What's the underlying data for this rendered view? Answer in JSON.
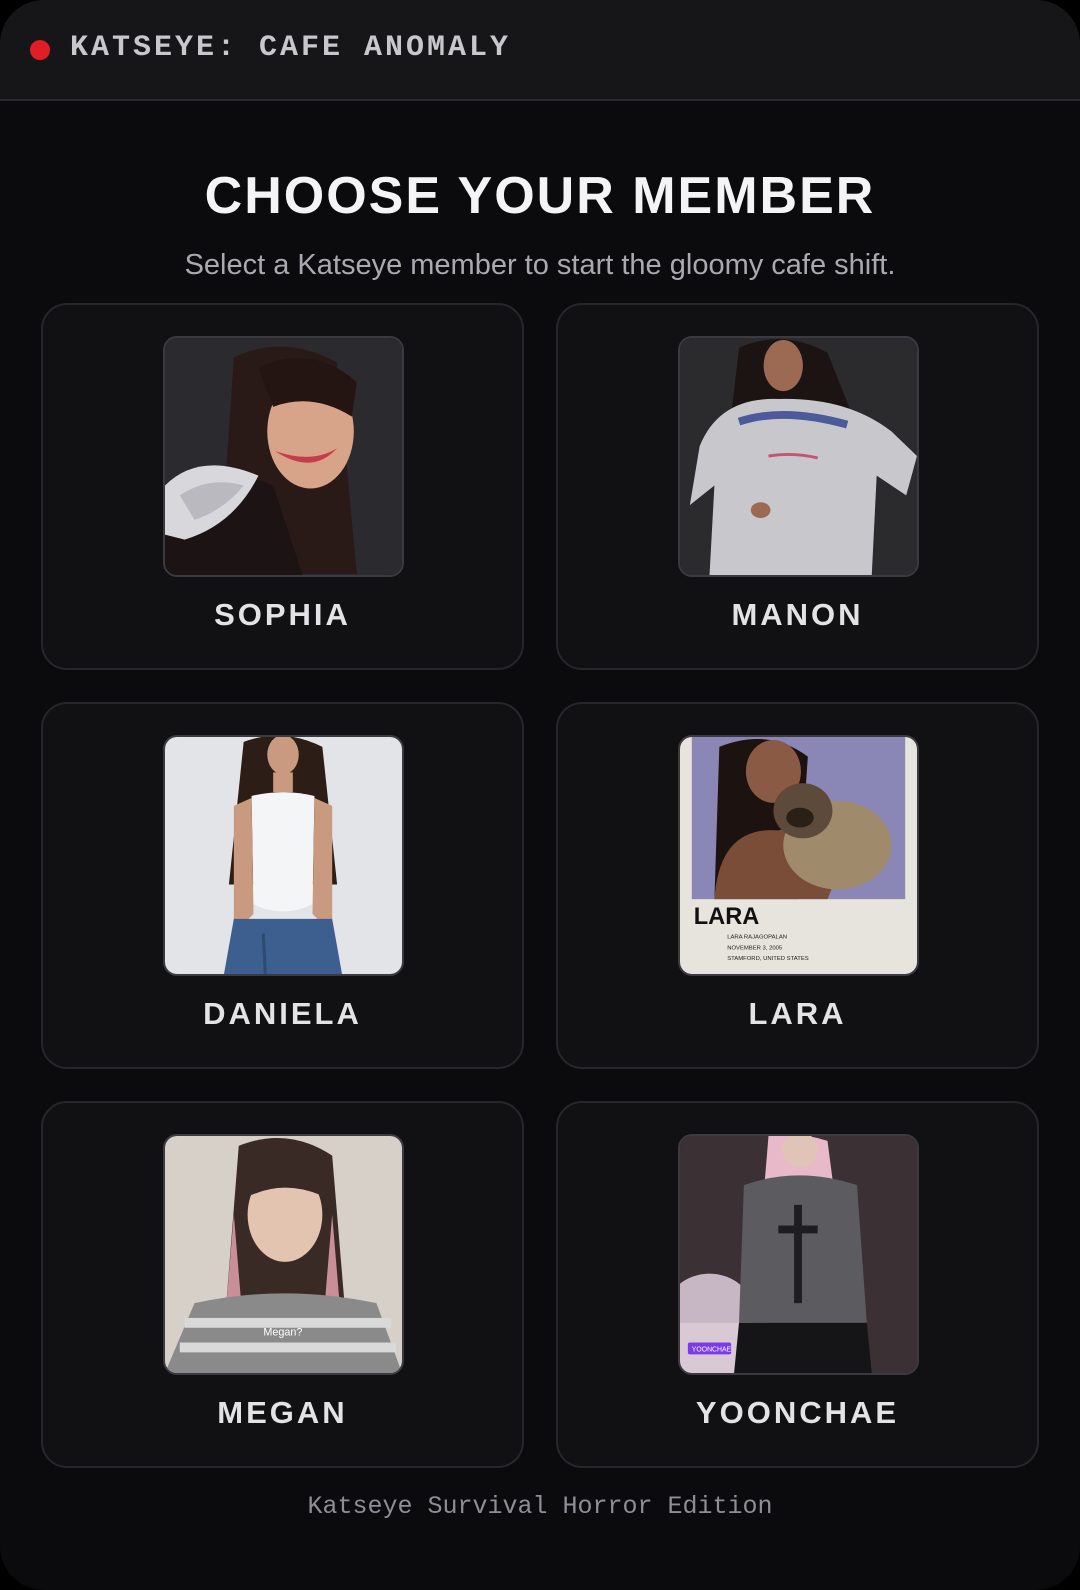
{
  "header": {
    "title": "KATSEYE: CAFE ANOMALY",
    "status_color": "#e11d26"
  },
  "select_screen": {
    "heading": "CHOOSE YOUR MEMBER",
    "subtitle": "Select a Katseye member to start the gloomy cafe shift."
  },
  "members": [
    {
      "name": "SOPHIA"
    },
    {
      "name": "MANON"
    },
    {
      "name": "DANIELA"
    },
    {
      "name": "LARA",
      "photo_text": {
        "title": "LARA",
        "line1": "LARA RAJAGOPALAN",
        "line2": "NOVEMBER 3, 2005",
        "line3": "STAMFORD, UNITED STATES"
      }
    },
    {
      "name": "MEGAN",
      "photo_text": {
        "caption": "Megan?"
      }
    },
    {
      "name": "YOONCHAE",
      "photo_text": {
        "tag": "YOONCHAE"
      }
    }
  ],
  "footer": {
    "text": "Katseye Survival Horror Edition"
  }
}
